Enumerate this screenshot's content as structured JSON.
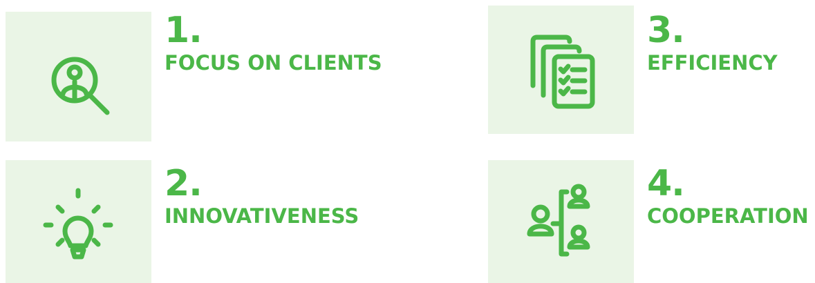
{
  "items": [
    {
      "number": "1.",
      "label": "FOCUS ON CLIENTS",
      "icon": "client-search-icon"
    },
    {
      "number": "2.",
      "label": "INNOVATIVENESS",
      "icon": "lightbulb-icon"
    },
    {
      "number": "3.",
      "label": "EFFICIENCY",
      "icon": "checklist-documents-icon"
    },
    {
      "number": "4.",
      "label": "COOPERATION",
      "icon": "team-cooperation-icon"
    }
  ],
  "colors": {
    "accent": "#4bb748",
    "tile_background": "#eaf5e6",
    "page_background": "#ffffff"
  }
}
